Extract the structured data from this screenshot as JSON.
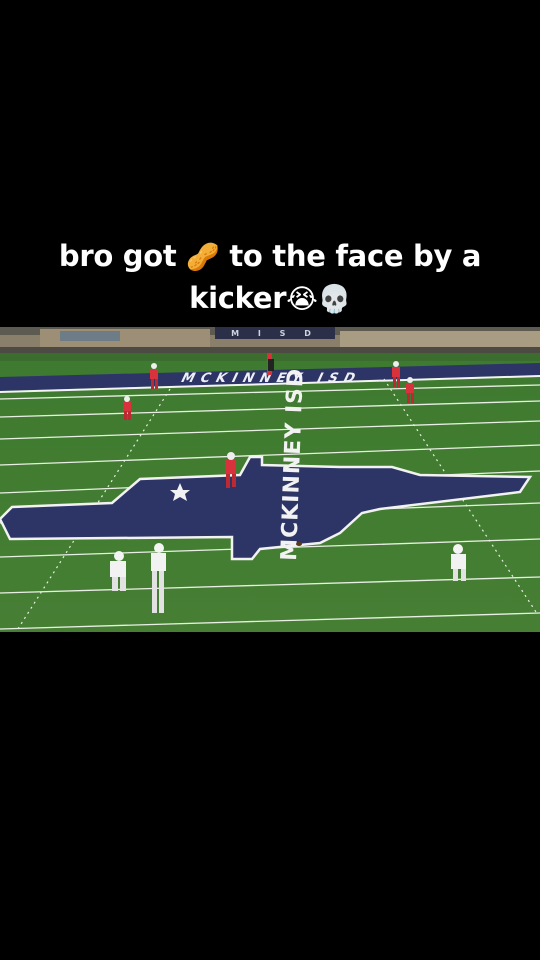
{
  "caption": {
    "text": "bro got 🥜 to the face by a kicker😭💀",
    "line1": "bro got",
    "emoji_peanut": "🥜",
    "line1_rest": "to the face by a",
    "line2": "kicker",
    "emoji_crying": "😭",
    "emoji_skull": "💀"
  },
  "video": {
    "sideline_banner_text": "MCKINNEY ISD",
    "midfield_logo_text": "MCKINNEY ISD",
    "stadium_sign_text": "M I S D",
    "colors": {
      "turf": "#3f7a30",
      "logo_navy": "#2d3566",
      "kicking_team_jersey": "#d8333d",
      "receiving_team_jersey": "#f2f2f2"
    }
  }
}
